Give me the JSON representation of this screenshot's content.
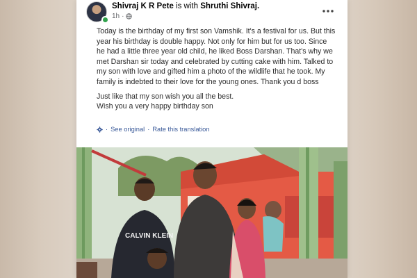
{
  "post": {
    "author": "Shivraj K R Pete",
    "with_text": "is with",
    "tagged": "Shruthi Shivraj.",
    "time": "1h",
    "separator": "·",
    "paragraphs": [
      "Today is the birthday of my first son Vamshik. It's a festival for us. But this year his birthday is double happy. Not only for him but for us too. Since he had a little three year old child, he liked Boss Darshan. That's why we met Darshan sir today and celebrated by cutting cake with him. Talked to my son with love and gifted him a photo of the wildlife that he took. My family is indebted to their love for the young ones. Thank you d boss",
      "Just like that my son wish you all the best.",
      "Wish you a very happy birthday son"
    ],
    "see_original": "See original",
    "rate_translation": "Rate this translation",
    "translation_separator": "·",
    "shirt_text": "CALVIN KLEIN",
    "icons": {
      "more": "more-horizontal-icon",
      "privacy": "globe-icon",
      "translation": "gear-icon"
    },
    "colors": {
      "link": "#385898",
      "online": "#31a24c",
      "wall": "#e45a45"
    }
  }
}
